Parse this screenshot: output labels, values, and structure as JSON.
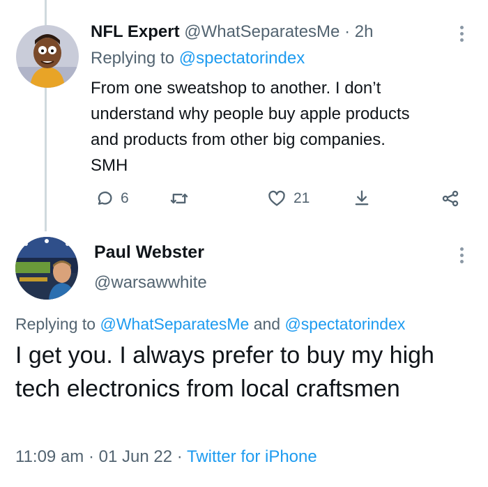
{
  "tweet1": {
    "name": "NFL Expert",
    "handle": "@WhatSeparatesMe",
    "separator": "·",
    "time": "2h",
    "replying_prefix": "Replying to",
    "replying_to": "@spectatorindex",
    "body": "From one sweatshop to another. I don’t\nunderstand why people buy apple products\nand products from other big companies.\nSMH",
    "replies": "6",
    "likes": "21",
    "icons": [
      "reply-icon",
      "retweet-icon",
      "heart-icon",
      "download-icon",
      "share-icon",
      "more-icon"
    ]
  },
  "tweet2": {
    "name": "Paul Webster",
    "handle": "@warsawwhite",
    "replying_prefix": "Replying to",
    "replying_to_1": "@WhatSeparatesMe",
    "replying_and": "and",
    "replying_to_2": "@spectatorindex",
    "body": "I get you. I always prefer to buy my high tech electronics from local craftsmen",
    "time": "11:09 am",
    "separator": "·",
    "date": "01 Jun 22",
    "source": "Twitter for iPhone"
  },
  "colors": {
    "accent": "#1d9bf0",
    "text": "#0f1419",
    "secondary": "#536471",
    "thread": "#cfd9de"
  }
}
